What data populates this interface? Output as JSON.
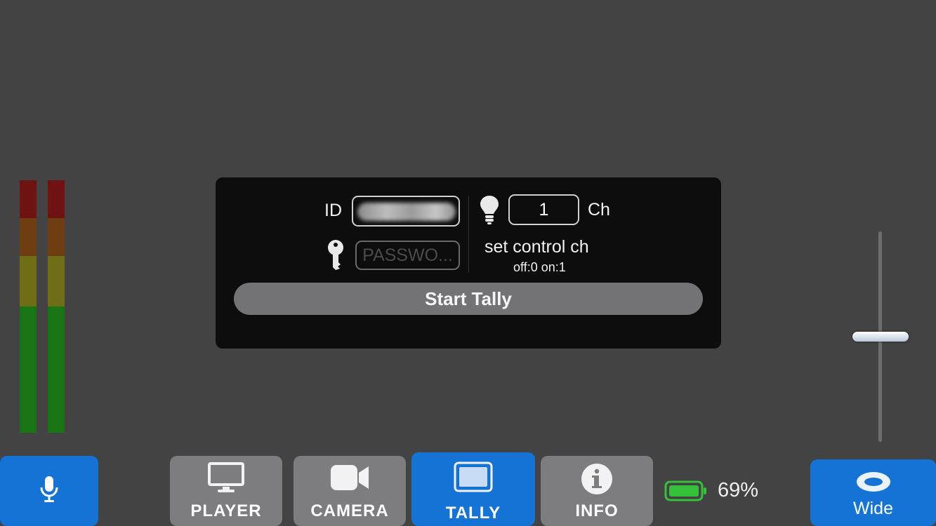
{
  "meters": {
    "count": 2
  },
  "tally_panel": {
    "id_label": "ID",
    "password_placeholder": "PASSWO...",
    "channel_value": "1",
    "channel_unit": "Ch",
    "set_control_label": "set control ch",
    "set_control_hint": "off:0 on:1",
    "start_button": "Start Tally"
  },
  "zoom_slider": {
    "value_fraction": 0.5
  },
  "bottom_bar": {
    "tabs": [
      {
        "label": "PLAYER",
        "icon": "monitor-icon"
      },
      {
        "label": "CAMERA",
        "icon": "video-camera-icon"
      },
      {
        "label": "TALLY",
        "icon": "tally-screen-icon",
        "active": true
      },
      {
        "label": "INFO",
        "icon": "info-icon"
      }
    ],
    "battery_percent": "69%",
    "lens_label": "Wide"
  },
  "colors": {
    "accent": "#1673d6",
    "inactive_tab": "#7d7d80",
    "battery": "#35c13a"
  }
}
